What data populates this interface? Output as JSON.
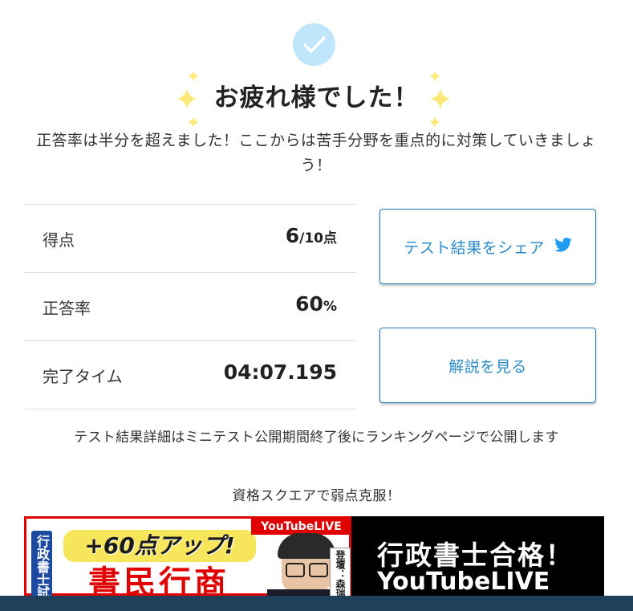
{
  "dialog": {
    "heading": "お疲れ様でした！",
    "lead": "正答率は半分を超えました！ここからは苦手分野を重点的に対策していきましょう！"
  },
  "stats": [
    {
      "label": "得点",
      "value": "6",
      "unit": "/10点"
    },
    {
      "label": "正答率",
      "value": "60",
      "unit": "%"
    },
    {
      "label": "完了タイム",
      "value": "04:07.195",
      "unit": ""
    }
  ],
  "buttons": {
    "share_label": "テスト結果をシェア",
    "share_icon": "twitter-icon",
    "explain_label": "解説を見る"
  },
  "notice": "テスト結果詳細はミニテスト公開期間終了後にランキングページで公開します",
  "promo": "資格スクエアで弱点克服！",
  "banner": {
    "vertical_label": "行政書士試",
    "yt_badge": "YouTubeLIVE",
    "headline": "+60点アップ!",
    "red_text": "書民行商",
    "speaker_tag": "登壇：森瑞",
    "right_line1": "行政書士合格！",
    "right_line2": "YouTubeLIVE"
  },
  "colors": {
    "accent": "#2b8cc4",
    "check_circle": "#bfe6fa",
    "sparkle": "#fbe97a"
  }
}
